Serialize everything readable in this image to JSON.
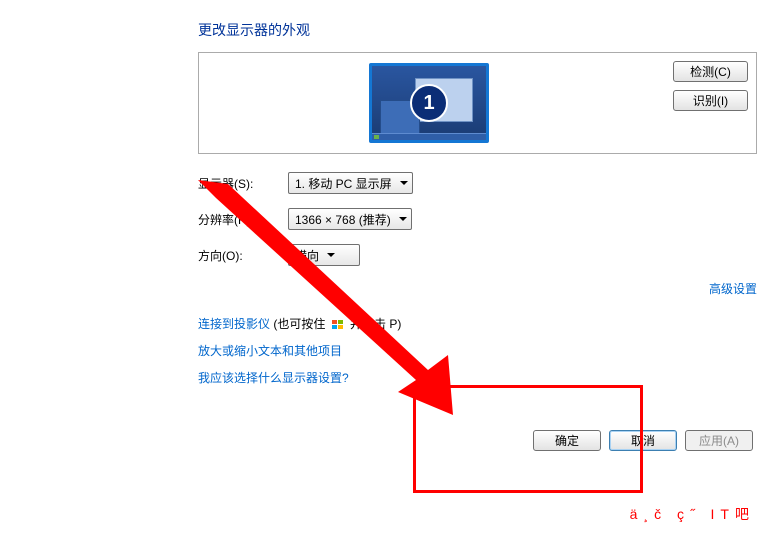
{
  "title": "更改显示器的外观",
  "preview": {
    "selected_monitor_number": "1"
  },
  "side_buttons": {
    "detect": "检测(C)",
    "identify": "识别(I)"
  },
  "fields": {
    "display_label": "显示器(S):",
    "display_value": "1. 移动 PC 显示屏",
    "resolution_label": "分辨率(R):",
    "resolution_value": "1366 × 768 (推荐)",
    "orientation_label": "方向(O):",
    "orientation_value": "横向"
  },
  "advanced_link": "高级设置",
  "links": {
    "projector_link": "连接到投影仪",
    "projector_suffix_a": " (也可按住 ",
    "projector_suffix_b": " 并点击 P)",
    "enlarge_text": "放大或缩小文本和其他项目",
    "which_settings": "我应该选择什么显示器设置?"
  },
  "buttons": {
    "ok": "确定",
    "cancel": "取消",
    "apply": "应用(A)"
  },
  "watermark": "ä¸č ç˝ IT吧"
}
